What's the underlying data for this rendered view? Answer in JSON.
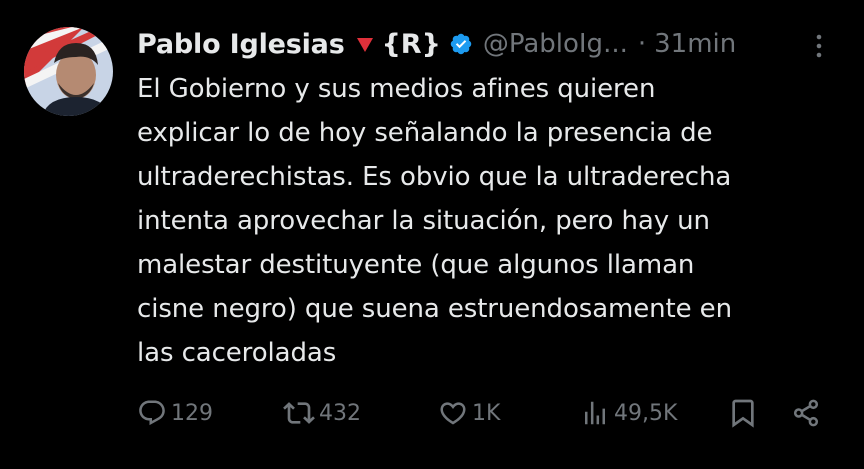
{
  "author": {
    "name": "Pablo Iglesias",
    "tag": "{R}",
    "handle": "@PabloIg...",
    "separator": "·",
    "time": "31min"
  },
  "tweet": {
    "lines": [
      "El Gobierno y sus medios afines quieren",
      "explicar lo de hoy señalando la presencia de",
      "ultraderechistas. Es obvio que la ultraderecha",
      "intenta aprovechar la situación, pero hay un",
      "malestar destituyente (que algunos llaman",
      "cisne negro) que suena estruendosamente en",
      "las caceroladas"
    ]
  },
  "metrics": {
    "replies": "129",
    "retweets": "432",
    "likes": "1K",
    "views": "49,5K"
  },
  "icons": {
    "verified": "verified-badge-icon",
    "more": "more-vertical-icon",
    "reply": "reply-icon",
    "retweet": "retweet-icon",
    "like": "heart-icon",
    "views": "views-bar-icon",
    "bookmark": "bookmark-icon",
    "share": "share-icon",
    "triangle": "red-triangle-icon"
  },
  "colors": {
    "background": "#000000",
    "text": "#e7e9ea",
    "muted": "#71767b",
    "verified": "#1d9bf0",
    "triangle": "#e0303a"
  }
}
